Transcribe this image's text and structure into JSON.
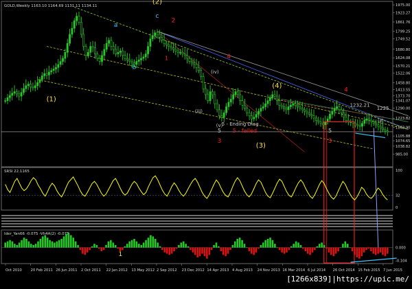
{
  "window": {
    "main_caption": "GOLD,Weekly  1163.10 1164.69 1131.11 1134.11",
    "rsi_caption": "SRSI 22.1165",
    "ao_caption": "Ider_Yan66 -0.075  -Vh4A(2) -0.075",
    "watermark": "[1266x839]|https://upic.me/"
  },
  "colors": {
    "background": "#000000",
    "bull_candle": "#22cc22",
    "bear_candle": "#22cc22",
    "rsi_line": "#ffff00",
    "hist_up": "#22cc22",
    "hist_down": "#dd1111",
    "highlight_box": "#ff2020",
    "label_yellow": "#ffe040",
    "label_red": "#ff2020",
    "label_cyan": "#3ec9ff",
    "label_white": "#ffffff",
    "label_gray": "#c8c8c8"
  },
  "chart_data": [
    {
      "type": "candlestick",
      "panel": "main",
      "ylim": [
        920,
        1980
      ],
      "y_ticks": [
        "1975.00",
        "1923.27",
        "1861.76",
        "1799.25",
        "1749.52",
        "1680.80",
        "1624.08",
        "1570.21",
        "1522.06",
        "1458.80",
        "1413.55",
        "1373.70",
        "1341.07",
        "1290.00",
        "1223.82",
        "1163.90",
        "1105.88",
        "1074.65",
        "1038.82",
        "985.00"
      ],
      "x_ticks": [
        "Oct 2010",
        "20 Feb 2011",
        "26 Jun 2011",
        "2 Oct 2011",
        "22 Jan 2012",
        "13 May 2012",
        "2 Sep 2012",
        "23 Dec 2012",
        "14 Apr 2013",
        "4 Aug 2013",
        "24 Nov 2013",
        "16 Mar 2014",
        "6 Jul 2014",
        "26 Oct 2014",
        "15 Feb 2015",
        "7 Jun 2015"
      ],
      "closes": [
        1340,
        1360,
        1375,
        1390,
        1400,
        1385,
        1370,
        1395,
        1420,
        1440,
        1450,
        1430,
        1425,
        1440,
        1460,
        1480,
        1505,
        1520,
        1510,
        1530,
        1540,
        1550,
        1560,
        1580,
        1600,
        1620,
        1660,
        1720,
        1780,
        1820,
        1870,
        1900,
        1860,
        1780,
        1700,
        1640,
        1660,
        1700,
        1690,
        1650,
        1620,
        1600,
        1640,
        1680,
        1720,
        1740,
        1700,
        1680,
        1650,
        1660,
        1670,
        1640,
        1620,
        1610,
        1600,
        1590,
        1580,
        1600,
        1610,
        1620,
        1630,
        1650,
        1700,
        1750,
        1770,
        1790,
        1780,
        1760,
        1740,
        1720,
        1710,
        1700,
        1690,
        1680,
        1670,
        1660,
        1660,
        1650,
        1640,
        1620,
        1600,
        1590,
        1580,
        1560,
        1540,
        1500,
        1420,
        1380,
        1340,
        1400,
        1380,
        1320,
        1280,
        1240,
        1230,
        1260,
        1300,
        1330,
        1350,
        1380,
        1400,
        1380,
        1340,
        1310,
        1290,
        1260,
        1240,
        1220,
        1230,
        1250,
        1270,
        1290,
        1300,
        1320,
        1340,
        1360,
        1380,
        1370,
        1340,
        1310,
        1300,
        1290,
        1280,
        1300,
        1310,
        1320,
        1310,
        1300,
        1290,
        1280,
        1270,
        1260,
        1250,
        1240,
        1225,
        1210,
        1200,
        1190,
        1180,
        1200,
        1220,
        1250,
        1270,
        1290,
        1300,
        1280,
        1260,
        1230,
        1210,
        1200,
        1200,
        1190,
        1180,
        1175,
        1170,
        1190,
        1210,
        1220,
        1210,
        1200,
        1190,
        1180,
        1170,
        1160,
        1150,
        1140,
        1134
      ]
    },
    {
      "type": "line",
      "panel": "oscillator",
      "name": "SRSI",
      "ylim": [
        0,
        100
      ],
      "y_ticks": [
        "100",
        "32",
        "0"
      ],
      "values": [
        62,
        48,
        40,
        55,
        70,
        78,
        65,
        52,
        45,
        50,
        60,
        72,
        80,
        74,
        60,
        50,
        38,
        30,
        42,
        56,
        65,
        58,
        45,
        35,
        28,
        40,
        55,
        68,
        75,
        82,
        70,
        58,
        44,
        34,
        30,
        40,
        52,
        64,
        70,
        62,
        50,
        38,
        30,
        36,
        48,
        60,
        72,
        78,
        66,
        52,
        40,
        33,
        38,
        50,
        62,
        70,
        64,
        52,
        42,
        34,
        40,
        55,
        68,
        80,
        85,
        74,
        60,
        46,
        36,
        30,
        42,
        56,
        66,
        58,
        46,
        36,
        30,
        38,
        50,
        62,
        72,
        78,
        68,
        54,
        40,
        30,
        24,
        34,
        48,
        62,
        74,
        66,
        52,
        40,
        32,
        28,
        40,
        56,
        70,
        80,
        72,
        58,
        44,
        34,
        28,
        36,
        50,
        64,
        74,
        68,
        54,
        40,
        30,
        26,
        38,
        52,
        66,
        76,
        70,
        56,
        42,
        32,
        28,
        40,
        54,
        66,
        74,
        66,
        52,
        40,
        30,
        24,
        34,
        48,
        62,
        72,
        64,
        50,
        38,
        28,
        22,
        30,
        44,
        58,
        70,
        62,
        48,
        36,
        26,
        20,
        28,
        40,
        54,
        48,
        36,
        28,
        24,
        30,
        42,
        52,
        46,
        34,
        26,
        20
      ],
      "hlines": [
        32
      ]
    },
    {
      "type": "bar",
      "panel": "histogram",
      "ylim": [
        -0.108,
        0.12
      ],
      "y_ticks": [
        "0.000",
        "-0.104"
      ],
      "values": [
        0.04,
        0.05,
        0.06,
        0.05,
        0.03,
        0.02,
        0.04,
        0.06,
        0.08,
        0.07,
        0.05,
        0.03,
        0.02,
        0.03,
        0.05,
        0.07,
        0.09,
        0.1,
        0.08,
        0.06,
        0.05,
        0.04,
        0.05,
        0.06,
        0.07,
        0.09,
        0.11,
        0.12,
        0.1,
        0.08,
        0.05,
        0.02,
        -0.02,
        -0.05,
        -0.06,
        -0.04,
        -0.02,
        0.01,
        0.03,
        0.02,
        -0.01,
        -0.03,
        -0.02,
        0.02,
        0.05,
        0.06,
        0.04,
        0.02,
        -0.01,
        -0.03,
        -0.02,
        0.01,
        0.03,
        0.05,
        0.06,
        0.07,
        0.05,
        0.03,
        0.02,
        0.04,
        0.06,
        0.08,
        0.1,
        0.09,
        0.07,
        0.04,
        0.01,
        -0.02,
        -0.04,
        -0.05,
        -0.06,
        -0.05,
        -0.03,
        -0.01,
        0.02,
        0.04,
        0.05,
        0.03,
        0.01,
        -0.02,
        -0.04,
        -0.06,
        -0.08,
        -0.07,
        -0.05,
        -0.07,
        -0.09,
        -0.06,
        -0.02,
        0.02,
        0.04,
        0.01,
        -0.03,
        -0.06,
        -0.07,
        -0.05,
        -0.02,
        0.02,
        0.05,
        0.07,
        0.08,
        0.06,
        0.03,
        0.0,
        -0.03,
        -0.05,
        -0.06,
        -0.04,
        -0.01,
        0.02,
        0.04,
        0.06,
        0.07,
        0.08,
        0.06,
        0.03,
        0.0,
        -0.02,
        -0.04,
        -0.05,
        -0.04,
        -0.02,
        0.01,
        0.03,
        0.05,
        0.04,
        0.02,
        -0.01,
        -0.03,
        -0.05,
        -0.06,
        -0.04,
        -0.02,
        0.01,
        0.03,
        0.04,
        0.02,
        -0.01,
        -0.04,
        -0.06,
        -0.07,
        -0.05,
        -0.03,
        0.0,
        0.03,
        0.05,
        0.03,
        0.0,
        -0.03,
        -0.06,
        -0.08,
        -0.09,
        -0.07,
        -0.04,
        -0.02,
        -0.01,
        -0.03,
        -0.05,
        -0.06,
        -0.05,
        -0.04,
        -0.06,
        -0.07,
        -0.05
      ]
    }
  ],
  "annotations": [
    {
      "text": "(1)",
      "series_index": 20,
      "price": 1500,
      "color": "label_yellow",
      "size": 10,
      "dy": 36
    },
    {
      "text": "(2)",
      "series_index": 66,
      "price": 1800,
      "color": "label_yellow",
      "size": 10,
      "dy": -40
    },
    {
      "text": "(3)",
      "series_index": 111,
      "price": 1165,
      "color": "label_yellow",
      "size": 10,
      "dy": 30
    },
    {
      "text": "(4)",
      "series_index": 118,
      "price": 1380,
      "color": "label_yellow",
      "size": 10,
      "dy": -10
    },
    {
      "text": "a",
      "series_index": 48,
      "price": 1830,
      "color": "label_cyan",
      "size": 9,
      "dy": 0
    },
    {
      "text": "b",
      "series_index": 56,
      "price": 1550,
      "color": "label_cyan",
      "size": 9,
      "dy": 0
    },
    {
      "text": "c",
      "series_index": 66,
      "price": 1890,
      "color": "label_cyan",
      "size": 9,
      "dy": 0
    },
    {
      "text": "2",
      "series_index": 73,
      "price": 1860,
      "color": "label_red",
      "size": 9,
      "dy": 0
    },
    {
      "text": "1",
      "series_index": 70,
      "price": 1610,
      "color": "label_red",
      "size": 8,
      "dy": 0
    },
    {
      "text": "4",
      "series_index": 97,
      "price": 1620,
      "color": "label_red",
      "size": 9,
      "dy": 0
    },
    {
      "text": "(iii)",
      "series_index": 84,
      "price": 1260,
      "color": "label_gray",
      "size": 7,
      "dy": 0
    },
    {
      "text": "(iv)",
      "series_index": 91,
      "price": 1520,
      "color": "label_gray",
      "size": 7,
      "dy": 0
    },
    {
      "text": "(v)",
      "series_index": 93,
      "price": 1165,
      "color": "label_gray",
      "size": 7,
      "dy": 0
    },
    {
      "text": "5",
      "series_index": 93,
      "price": 1130,
      "color": "label_gray",
      "size": 8,
      "dy": 0
    },
    {
      "text": "3",
      "series_index": 93,
      "price": 1060,
      "color": "label_red",
      "size": 9,
      "dy": 0
    },
    {
      "text": "5 - Ending Diag",
      "series_index": 102,
      "price": 1175,
      "color": "label_gray",
      "size": 7,
      "dy": 0
    },
    {
      "text": "5 - failed",
      "series_index": 104,
      "price": 1130,
      "color": "label_red",
      "size": 8,
      "dy": 0
    },
    {
      "text": "4",
      "series_index": 148,
      "price": 1400,
      "color": "label_red",
      "size": 9,
      "dy": 0
    },
    {
      "text": "5",
      "series_index": 141,
      "price": 1130,
      "color": "label_gray",
      "size": 8,
      "dy": 0
    },
    {
      "text": "3",
      "series_index": 141,
      "price": 1060,
      "color": "label_red",
      "size": 9,
      "dy": 0
    },
    {
      "text": "1232.21",
      "series_index": 154,
      "price": 1300,
      "color": "label_gray",
      "size": 7,
      "dy": 0
    },
    {
      "text": "1225",
      "series_index": 164,
      "price": 1280,
      "color": "label_gray",
      "size": 7,
      "dy": 0
    },
    {
      "text": "(a)",
      "series_index": 163,
      "price": 1200,
      "color": "label_gray",
      "size": 6,
      "dy": 0
    },
    {
      "text": "1",
      "series_index": 50,
      "price": -0.07,
      "color": "label_yellow",
      "size": 9,
      "dy": 0,
      "panel": "histogram"
    }
  ],
  "trendlines": [
    {
      "from": [
        66,
        1800
      ],
      "to": [
        175,
        1150
      ],
      "color": "#4a6cff",
      "dash": false
    },
    {
      "from": [
        66,
        1800
      ],
      "to": [
        175,
        1240
      ],
      "color": "#a0a0a0",
      "dash": false
    },
    {
      "from": [
        66,
        1800
      ],
      "to": [
        130,
        1000
      ],
      "color": "#a02020",
      "dash": false
    },
    {
      "from": [
        30,
        1960
      ],
      "to": [
        175,
        1150
      ],
      "color": "#9acd32",
      "dash": true
    },
    {
      "from": [
        18,
        1700
      ],
      "to": [
        175,
        1150
      ],
      "color": "#c0c020",
      "dash": true
    },
    {
      "from": [
        14,
        1480
      ],
      "to": [
        160,
        1020
      ],
      "color": "#c0c020",
      "dash": true
    },
    {
      "from": [
        120,
        1350
      ],
      "to": [
        175,
        1200
      ],
      "color": "#2e8b57",
      "dash": false
    },
    {
      "from": [
        118,
        1345
      ],
      "to": [
        165,
        1230
      ],
      "color": "#c0392b",
      "dash": true
    }
  ]
}
